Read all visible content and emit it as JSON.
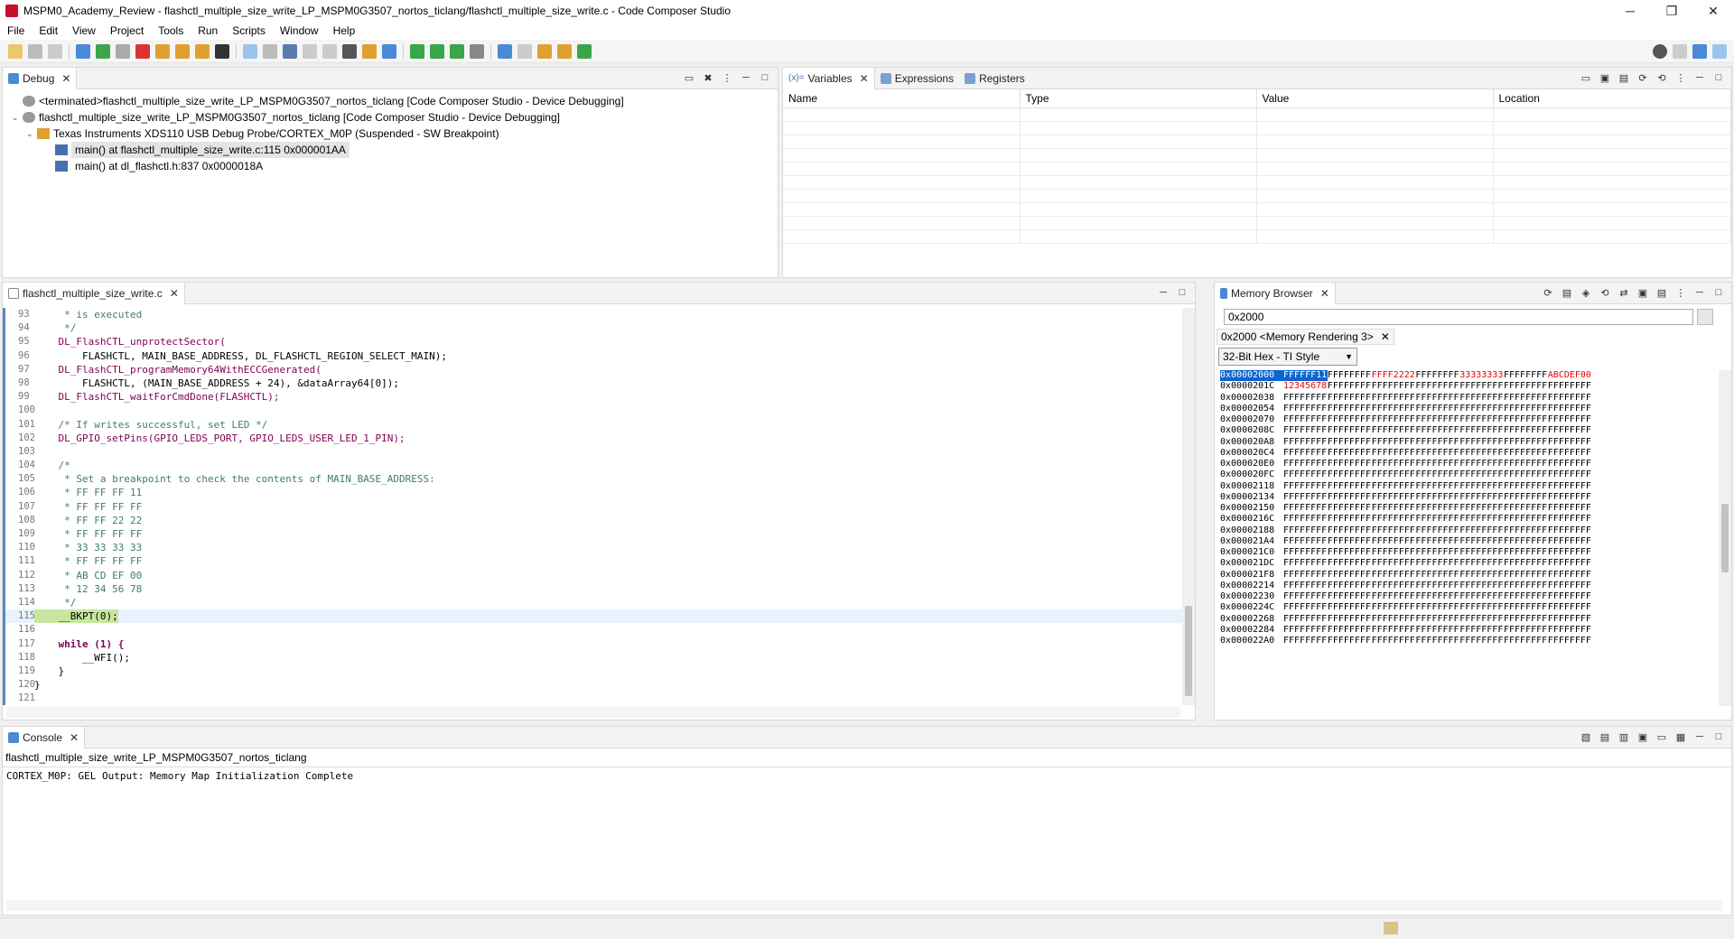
{
  "window": {
    "title": "MSPM0_Academy_Review - flashctl_multiple_size_write_LP_MSPM0G3507_nortos_ticlang/flashctl_multiple_size_write.c - Code Composer Studio",
    "minimize": "─",
    "maximize": "❐",
    "close": "✕"
  },
  "menu": [
    "File",
    "Edit",
    "View",
    "Project",
    "Tools",
    "Run",
    "Scripts",
    "Window",
    "Help"
  ],
  "debug": {
    "tab": "Debug",
    "items": [
      {
        "twisty": "",
        "label": "<terminated>flashctl_multiple_size_write_LP_MSPM0G3507_nortos_ticlang [Code Composer Studio - Device Debugging]"
      },
      {
        "twisty": "⌄",
        "label": "flashctl_multiple_size_write_LP_MSPM0G3507_nortos_ticlang [Code Composer Studio - Device Debugging]"
      },
      {
        "twisty": "⌄",
        "label": "Texas Instruments XDS110 USB Debug Probe/CORTEX_M0P (Suspended - SW Breakpoint)"
      },
      {
        "twisty": "",
        "label": "main() at flashctl_multiple_size_write.c:115 0x000001AA"
      },
      {
        "twisty": "",
        "label": "main() at dl_flashctl.h:837 0x0000018A"
      }
    ]
  },
  "variables": {
    "tabs": [
      "Variables",
      "Expressions",
      "Registers"
    ],
    "columns": [
      "Name",
      "Type",
      "Value",
      "Location"
    ]
  },
  "editor": {
    "tab": "flashctl_multiple_size_write.c",
    "lines": [
      {
        "n": "93",
        "t": "     * is executed"
      },
      {
        "n": "94",
        "t": "     */"
      },
      {
        "n": "95",
        "t": "    DL_FlashCTL_unprotectSector("
      },
      {
        "n": "96",
        "t": "        FLASHCTL, MAIN_BASE_ADDRESS, DL_FLASHCTL_REGION_SELECT_MAIN);"
      },
      {
        "n": "97",
        "t": "    DL_FlashCTL_programMemory64WithECCGenerated("
      },
      {
        "n": "98",
        "t": "        FLASHCTL, (MAIN_BASE_ADDRESS + 24), &dataArray64[0]);"
      },
      {
        "n": "99",
        "t": "    DL_FlashCTL_waitForCmdDone(FLASHCTL);"
      },
      {
        "n": "100",
        "t": ""
      },
      {
        "n": "101",
        "t": "    /* If writes successful, set LED */"
      },
      {
        "n": "102",
        "t": "    DL_GPIO_setPins(GPIO_LEDS_PORT, GPIO_LEDS_USER_LED_1_PIN);"
      },
      {
        "n": "103",
        "t": ""
      },
      {
        "n": "104",
        "t": "    /*"
      },
      {
        "n": "105",
        "t": "     * Set a breakpoint to check the contents of MAIN_BASE_ADDRESS:"
      },
      {
        "n": "106",
        "t": "     * FF FF FF 11"
      },
      {
        "n": "107",
        "t": "     * FF FF FF FF"
      },
      {
        "n": "108",
        "t": "     * FF FF 22 22"
      },
      {
        "n": "109",
        "t": "     * FF FF FF FF"
      },
      {
        "n": "110",
        "t": "     * 33 33 33 33"
      },
      {
        "n": "111",
        "t": "     * FF FF FF FF"
      },
      {
        "n": "112",
        "t": "     * AB CD EF 00"
      },
      {
        "n": "113",
        "t": "     * 12 34 56 78"
      },
      {
        "n": "114",
        "t": "     */"
      },
      {
        "n": "115",
        "t": "    __BKPT(0);"
      },
      {
        "n": "116",
        "t": ""
      },
      {
        "n": "117",
        "t": "    while (1) {"
      },
      {
        "n": "118",
        "t": "        __WFI();"
      },
      {
        "n": "119",
        "t": "    }"
      },
      {
        "n": "120",
        "t": "}"
      },
      {
        "n": "121",
        "t": ""
      }
    ]
  },
  "memory": {
    "tab": "Memory Browser",
    "address_input": "0x2000",
    "rendering_tab": "0x2000 <Memory Rendering 3>",
    "format": "32-Bit Hex - TI Style",
    "rows": [
      {
        "addr": "0x00002000",
        "vals": [
          "FFFFFF11",
          "FFFFFFFF",
          "FFFF2222",
          "FFFFFFFF",
          "33333333",
          "FFFFFFFF",
          "ABCDEF00"
        ]
      },
      {
        "addr": "0x0000201C",
        "vals": [
          "12345678",
          "FFFFFFFF",
          "FFFFFFFF",
          "FFFFFFFF",
          "FFFFFFFF",
          "FFFFFFFF",
          "FFFFFFFF"
        ]
      },
      {
        "addr": "0x00002038",
        "vals": [
          "FFFFFFFF",
          "FFFFFFFF",
          "FFFFFFFF",
          "FFFFFFFF",
          "FFFFFFFF",
          "FFFFFFFF",
          "FFFFFFFF"
        ]
      },
      {
        "addr": "0x00002054",
        "vals": [
          "FFFFFFFF",
          "FFFFFFFF",
          "FFFFFFFF",
          "FFFFFFFF",
          "FFFFFFFF",
          "FFFFFFFF",
          "FFFFFFFF"
        ]
      },
      {
        "addr": "0x00002070",
        "vals": [
          "FFFFFFFF",
          "FFFFFFFF",
          "FFFFFFFF",
          "FFFFFFFF",
          "FFFFFFFF",
          "FFFFFFFF",
          "FFFFFFFF"
        ]
      },
      {
        "addr": "0x0000208C",
        "vals": [
          "FFFFFFFF",
          "FFFFFFFF",
          "FFFFFFFF",
          "FFFFFFFF",
          "FFFFFFFF",
          "FFFFFFFF",
          "FFFFFFFF"
        ]
      },
      {
        "addr": "0x000020A8",
        "vals": [
          "FFFFFFFF",
          "FFFFFFFF",
          "FFFFFFFF",
          "FFFFFFFF",
          "FFFFFFFF",
          "FFFFFFFF",
          "FFFFFFFF"
        ]
      },
      {
        "addr": "0x000020C4",
        "vals": [
          "FFFFFFFF",
          "FFFFFFFF",
          "FFFFFFFF",
          "FFFFFFFF",
          "FFFFFFFF",
          "FFFFFFFF",
          "FFFFFFFF"
        ]
      },
      {
        "addr": "0x000020E0",
        "vals": [
          "FFFFFFFF",
          "FFFFFFFF",
          "FFFFFFFF",
          "FFFFFFFF",
          "FFFFFFFF",
          "FFFFFFFF",
          "FFFFFFFF"
        ]
      },
      {
        "addr": "0x000020FC",
        "vals": [
          "FFFFFFFF",
          "FFFFFFFF",
          "FFFFFFFF",
          "FFFFFFFF",
          "FFFFFFFF",
          "FFFFFFFF",
          "FFFFFFFF"
        ]
      },
      {
        "addr": "0x00002118",
        "vals": [
          "FFFFFFFF",
          "FFFFFFFF",
          "FFFFFFFF",
          "FFFFFFFF",
          "FFFFFFFF",
          "FFFFFFFF",
          "FFFFFFFF"
        ]
      },
      {
        "addr": "0x00002134",
        "vals": [
          "FFFFFFFF",
          "FFFFFFFF",
          "FFFFFFFF",
          "FFFFFFFF",
          "FFFFFFFF",
          "FFFFFFFF",
          "FFFFFFFF"
        ]
      },
      {
        "addr": "0x00002150",
        "vals": [
          "FFFFFFFF",
          "FFFFFFFF",
          "FFFFFFFF",
          "FFFFFFFF",
          "FFFFFFFF",
          "FFFFFFFF",
          "FFFFFFFF"
        ]
      },
      {
        "addr": "0x0000216C",
        "vals": [
          "FFFFFFFF",
          "FFFFFFFF",
          "FFFFFFFF",
          "FFFFFFFF",
          "FFFFFFFF",
          "FFFFFFFF",
          "FFFFFFFF"
        ]
      },
      {
        "addr": "0x00002188",
        "vals": [
          "FFFFFFFF",
          "FFFFFFFF",
          "FFFFFFFF",
          "FFFFFFFF",
          "FFFFFFFF",
          "FFFFFFFF",
          "FFFFFFFF"
        ]
      },
      {
        "addr": "0x000021A4",
        "vals": [
          "FFFFFFFF",
          "FFFFFFFF",
          "FFFFFFFF",
          "FFFFFFFF",
          "FFFFFFFF",
          "FFFFFFFF",
          "FFFFFFFF"
        ]
      },
      {
        "addr": "0x000021C0",
        "vals": [
          "FFFFFFFF",
          "FFFFFFFF",
          "FFFFFFFF",
          "FFFFFFFF",
          "FFFFFFFF",
          "FFFFFFFF",
          "FFFFFFFF"
        ]
      },
      {
        "addr": "0x000021DC",
        "vals": [
          "FFFFFFFF",
          "FFFFFFFF",
          "FFFFFFFF",
          "FFFFFFFF",
          "FFFFFFFF",
          "FFFFFFFF",
          "FFFFFFFF"
        ]
      },
      {
        "addr": "0x000021F8",
        "vals": [
          "FFFFFFFF",
          "FFFFFFFF",
          "FFFFFFFF",
          "FFFFFFFF",
          "FFFFFFFF",
          "FFFFFFFF",
          "FFFFFFFF"
        ]
      },
      {
        "addr": "0x00002214",
        "vals": [
          "FFFFFFFF",
          "FFFFFFFF",
          "FFFFFFFF",
          "FFFFFFFF",
          "FFFFFFFF",
          "FFFFFFFF",
          "FFFFFFFF"
        ]
      },
      {
        "addr": "0x00002230",
        "vals": [
          "FFFFFFFF",
          "FFFFFFFF",
          "FFFFFFFF",
          "FFFFFFFF",
          "FFFFFFFF",
          "FFFFFFFF",
          "FFFFFFFF"
        ]
      },
      {
        "addr": "0x0000224C",
        "vals": [
          "FFFFFFFF",
          "FFFFFFFF",
          "FFFFFFFF",
          "FFFFFFFF",
          "FFFFFFFF",
          "FFFFFFFF",
          "FFFFFFFF"
        ]
      },
      {
        "addr": "0x00002268",
        "vals": [
          "FFFFFFFF",
          "FFFFFFFF",
          "FFFFFFFF",
          "FFFFFFFF",
          "FFFFFFFF",
          "FFFFFFFF",
          "FFFFFFFF"
        ]
      },
      {
        "addr": "0x00002284",
        "vals": [
          "FFFFFFFF",
          "FFFFFFFF",
          "FFFFFFFF",
          "FFFFFFFF",
          "FFFFFFFF",
          "FFFFFFFF",
          "FFFFFFFF"
        ]
      },
      {
        "addr": "0x000022A0",
        "vals": [
          "FFFFFFFF",
          "FFFFFFFF",
          "FFFFFFFF",
          "FFFFFFFF",
          "FFFFFFFF",
          "FFFFFFFF",
          "FFFFFFFF"
        ]
      }
    ]
  },
  "console": {
    "tab": "Console",
    "subtitle": "flashctl_multiple_size_write_LP_MSPM0G3507_nortos_ticlang",
    "output": "CORTEX_M0P: GEL Output: Memory Map Initialization Complete"
  },
  "colors": {
    "accent": "#0a64d2",
    "changed": "#e00000",
    "comment": "#3f7f5f",
    "keyword": "#7f0055",
    "breakpoint_line": "#c8e6a0"
  }
}
